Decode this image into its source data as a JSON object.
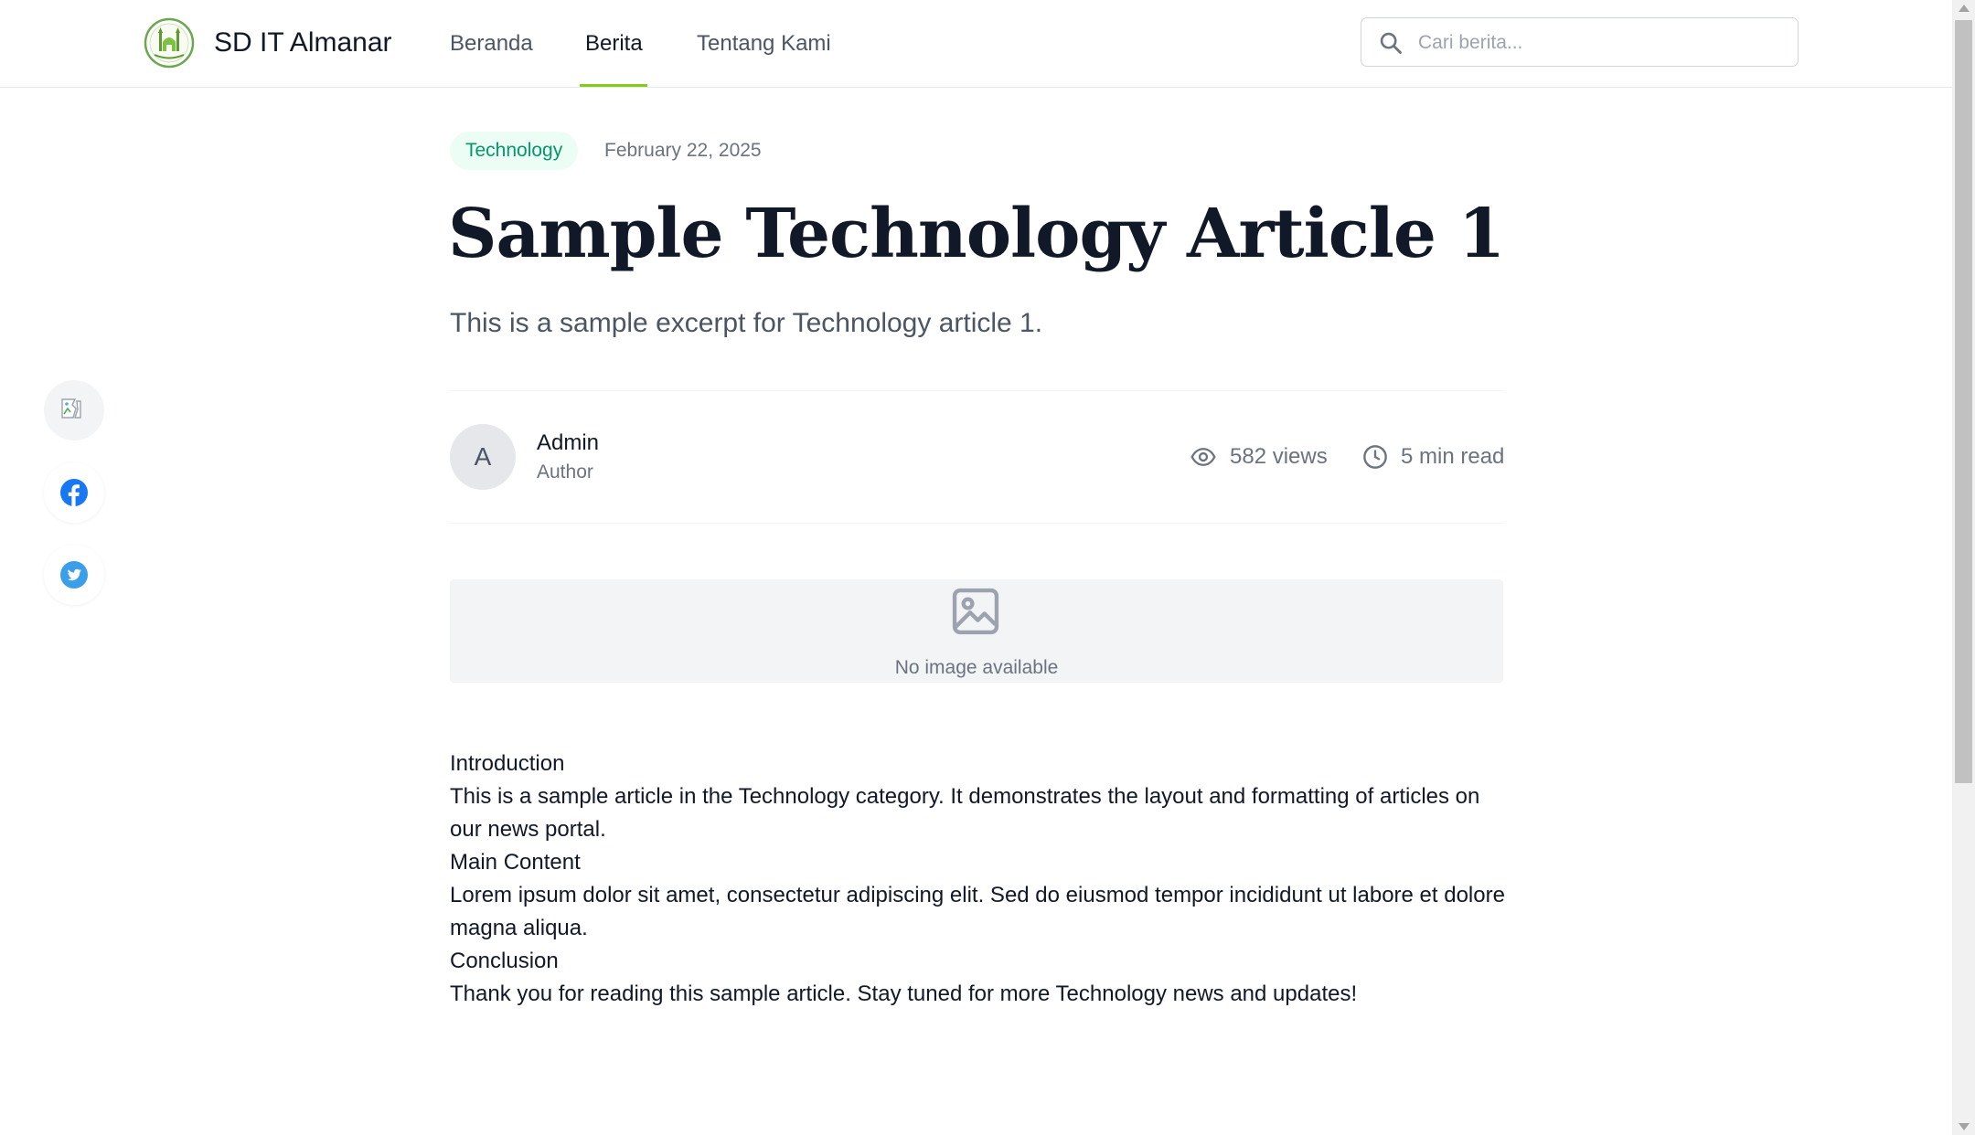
{
  "header": {
    "brand": "SD IT Almanar",
    "logo_icon": "school-mosque-logo",
    "nav": [
      {
        "label": "Beranda",
        "active": false
      },
      {
        "label": "Berita",
        "active": true
      },
      {
        "label": "Tentang Kami",
        "active": false
      }
    ],
    "search": {
      "placeholder": "Cari berita...",
      "value": "",
      "icon": "search-icon"
    },
    "accent_color": "#84cc16"
  },
  "share": {
    "buttons": [
      {
        "name": "broken-image",
        "icon": "broken-image-icon"
      },
      {
        "name": "facebook",
        "icon": "facebook-icon",
        "color": "#1877f2"
      },
      {
        "name": "twitter",
        "icon": "twitter-icon",
        "color": "#3b9ee8"
      }
    ]
  },
  "article": {
    "category": "Technology",
    "category_color": "#059669",
    "date": "February 22, 2025",
    "title": "Sample Technology Article 1",
    "excerpt": "This is a sample excerpt for Technology article 1.",
    "author": {
      "initial": "A",
      "name": "Admin",
      "role": "Author"
    },
    "views": "582 views",
    "read_time": "5 min read",
    "image_placeholder": "No image available",
    "body": [
      "Introduction",
      "This is a sample article in the Technology category. It demonstrates the layout and formatting of articles on our news portal.",
      "Main Content",
      "Lorem ipsum dolor sit amet, consectetur adipiscing elit. Sed do eiusmod tempor incididunt ut labore et dolore magna aliqua.",
      "Conclusion",
      "Thank you for reading this sample article. Stay tuned for more Technology news and updates!"
    ]
  }
}
